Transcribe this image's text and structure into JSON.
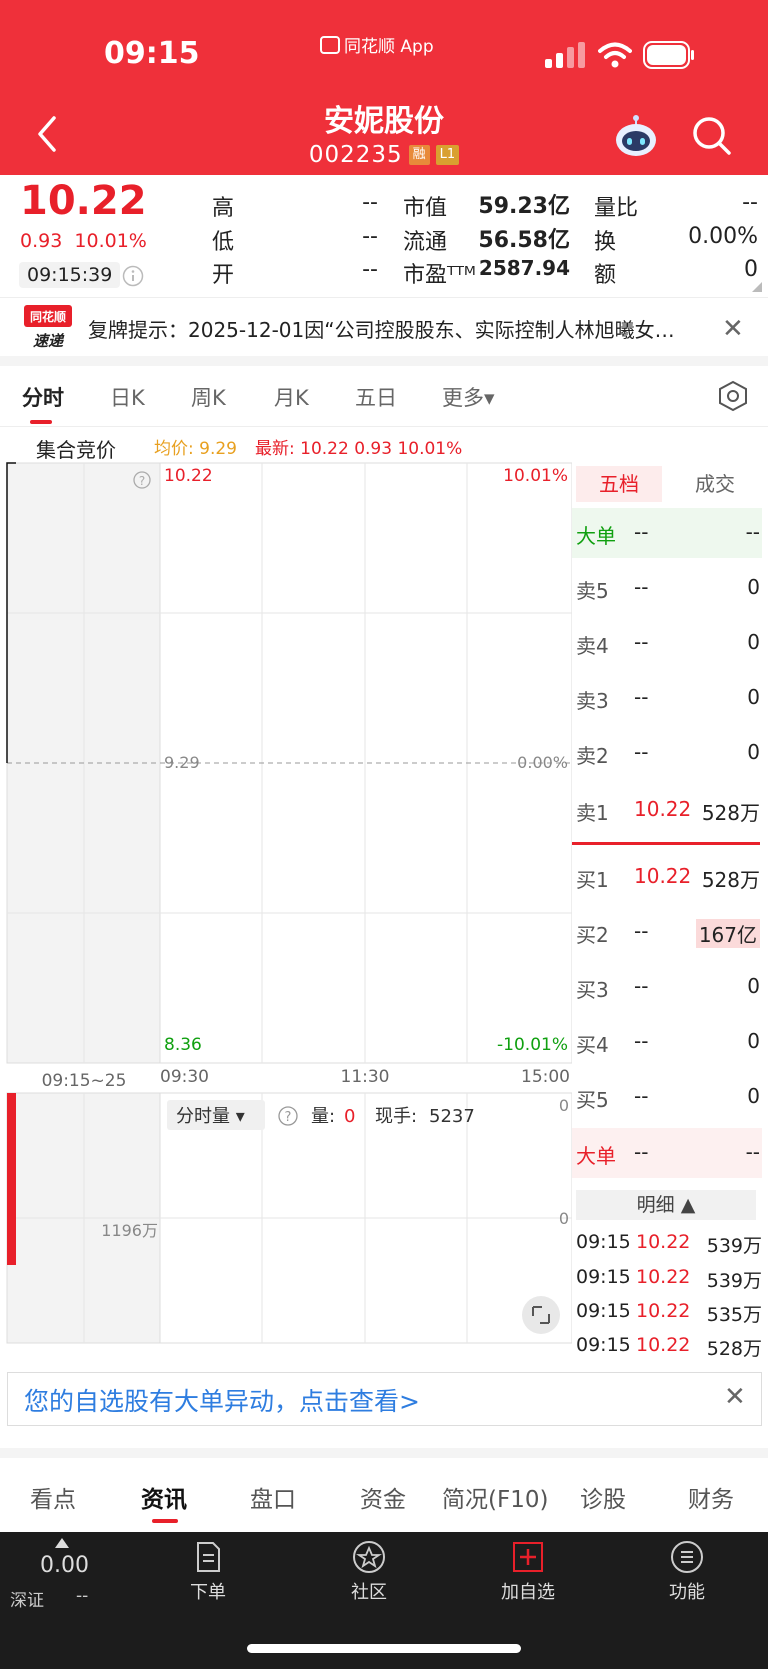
{
  "status": {
    "time": "09:15",
    "app_name": "同花顺 App"
  },
  "header": {
    "stock_name": "安妮股份",
    "stock_code": "002235",
    "tag_margin": "融",
    "tag_level": "L1"
  },
  "quote": {
    "price": "10.22",
    "change": "0.93",
    "change_pct": "10.01%",
    "time": "09:15:39",
    "high_label": "高",
    "high": "--",
    "low_label": "低",
    "low": "--",
    "open_label": "开",
    "open": "--",
    "mktcap_label": "市值",
    "mktcap": "59.23亿",
    "float_label": "流通",
    "float": "56.58亿",
    "pe_label": "市盈ᵀᵀᴹ",
    "pe": "2587.94",
    "volratio_label": "量比",
    "volratio": "--",
    "turnover_label": "换",
    "turnover": "0.00%",
    "amount_label": "额",
    "amount": "0"
  },
  "ticker": {
    "logo_top": "同花顺",
    "logo_bottom": "速递",
    "text": "复牌提示：2025-12-01因“公司控股股东、实际控制人林旭曦女…"
  },
  "chart_tabs": [
    "分时",
    "日K",
    "周K",
    "月K",
    "五日",
    "更多▾"
  ],
  "auction": {
    "label": "集合竞价",
    "avg": "均价: 9.29",
    "latest": "最新: 10.22  0.93  10.01%"
  },
  "chart": {
    "top_left": "10.22",
    "top_right": "10.01%",
    "mid_left": "9.29",
    "mid_right": "0.00%",
    "bottom_left": "8.36",
    "bottom_right": "-10.01%",
    "x_auction": "09:15~25",
    "x_open": "09:30",
    "x_mid": "11:30",
    "x_close": "15:00",
    "vol_mode": "分时量 ▾",
    "vol_label": "量:",
    "vol_value": "0",
    "hand_label": "现手:",
    "hand_value": "5237",
    "vol_axis_top": "0",
    "vol_axis_mid": "0",
    "auction_vol": "1196万"
  },
  "orderbook": {
    "tab_five": "五档",
    "tab_deal": "成交",
    "big_sell": {
      "label": "大单",
      "price": "--",
      "vol": "--"
    },
    "sells": [
      {
        "label": "卖5",
        "price": "--",
        "vol": "0"
      },
      {
        "label": "卖4",
        "price": "--",
        "vol": "0"
      },
      {
        "label": "卖3",
        "price": "--",
        "vol": "0"
      },
      {
        "label": "卖2",
        "price": "--",
        "vol": "0"
      },
      {
        "label": "卖1",
        "price": "10.22",
        "vol": "528万"
      }
    ],
    "buys": [
      {
        "label": "买1",
        "price": "10.22",
        "vol": "528万"
      },
      {
        "label": "买2",
        "price": "--",
        "vol": "167亿"
      },
      {
        "label": "买3",
        "price": "--",
        "vol": "0"
      },
      {
        "label": "买4",
        "price": "--",
        "vol": "0"
      },
      {
        "label": "买5",
        "price": "--",
        "vol": "0"
      }
    ],
    "big_buy": {
      "label": "大单",
      "price": "--",
      "vol": "--"
    },
    "detail_header": "明细 ▲",
    "details": [
      {
        "time": "09:15",
        "price": "10.22",
        "vol": "539万"
      },
      {
        "time": "09:15",
        "price": "10.22",
        "vol": "539万"
      },
      {
        "time": "09:15",
        "price": "10.22",
        "vol": "535万"
      },
      {
        "time": "09:15",
        "price": "10.22",
        "vol": "528万"
      }
    ]
  },
  "alert": {
    "text": "您的自选股有大单异动，点击查看>"
  },
  "info_tabs": [
    "看点",
    "资讯",
    "盘口",
    "资金",
    "简况(F10)",
    "诊股",
    "财务"
  ],
  "bottom": {
    "index_value": "0.00",
    "index_name": "深证",
    "index_change": "--",
    "nav": [
      "下单",
      "社区",
      "加自选",
      "功能"
    ]
  },
  "colors": {
    "up": "#e8202a",
    "down": "#10a010",
    "header": "#ef303a",
    "link": "#2e7de0"
  }
}
